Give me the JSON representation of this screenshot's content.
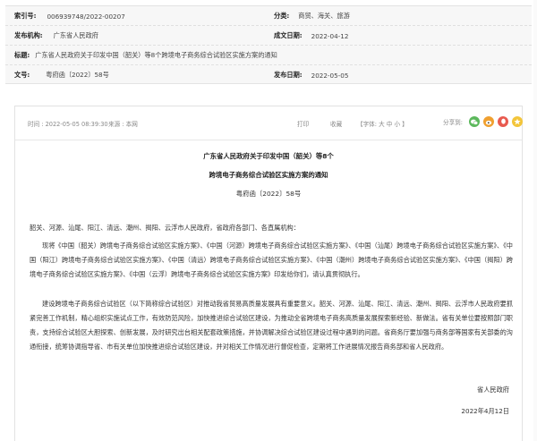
{
  "meta": {
    "index_label": "索引号:",
    "index_value": "006939748/2022-00207",
    "category_label": "分类:",
    "category_value": "商贸、海关、旅游",
    "issuer_label": "发布机构:",
    "issuer_value": "广东省人民政府",
    "date_label": "成文日期:",
    "date_value": "2022-04-12",
    "title_label": "标题:",
    "title_value": "广东省人民政府关于印发中国（韶关）等8个跨境电子商务综合试验区实施方案的通知",
    "docno_label": "文号:",
    "docno_value": "粤府函〔2022〕58号",
    "pubdate_label": "发布日期:",
    "pubdate_value": "2022-05-05"
  },
  "info_bar": {
    "time": "时间 : 2022-05-05 08:39:30",
    "source": "来源 : 本网",
    "print": "打印",
    "favorite": "收藏",
    "font_size": "【字体: 大  中  小 】",
    "share": "分享到:"
  },
  "article": {
    "title_line1": "广东省人民政府关于印发中国（韶关）等8个",
    "title_line2": "跨境电子商务综合试验区实施方案的通知",
    "doc_number": "粤府函〔2022〕58号",
    "salutation": "韶关、河源、汕尾、阳江、清远、潮州、揭阳、云浮市人民政府，省政府各部门、各直属机构：",
    "paragraph1": "现将《中国（韶关）跨境电子商务综合试验区实施方案》、《中国（河源）跨境电子商务综合试验区实施方案》、《中国（汕尾）跨境电子商务综合试验区实施方案》、《中国（阳江）跨境电子商务综合试验区实施方案》、《中国（清远）跨境电子商务综合试验区实施方案》、《中国（潮州）跨境电子商务综合试验区实施方案》、《中国（揭阳）跨境电子商务综合试验区实施方案》、《中国（云浮）跨境电子商务综合试验区实施方案》印发给你们，请认真贯彻执行。",
    "paragraph2": "建设跨境电子商务综合试验区（以下简称综合试验区）对推动我省贸易高质量发展具有重要意义。韶关、河源、汕尾、阳江、清远、潮州、揭阳、云浮市人民政府要抓紧完善工作机制，精心组织实施试点工作，有效防范风险，加快推进综合试验区建设，为推动全省跨境电子商务高质量发展探索新经验、新做法。省有关单位要按照部门职责，支持综合试验区大胆探索、创新发展，及时研究出台相关配套政策措施，并协调解决综合试验区建设过程中遇到的问题。省商务厅要加强与商务部等国家有关部委的沟通衔接，统筹协调指导省、市有关单位加快推进综合试验区建设，并对相关工作情况进行督促检查，定期将工作进展情况报告商务部和省人民政府。",
    "signer": "省人民政府",
    "sign_date": "2022年4月12日"
  },
  "share_icons": [
    "wechat-icon",
    "weibo-icon",
    "qq-icon",
    "qzone-icon"
  ]
}
